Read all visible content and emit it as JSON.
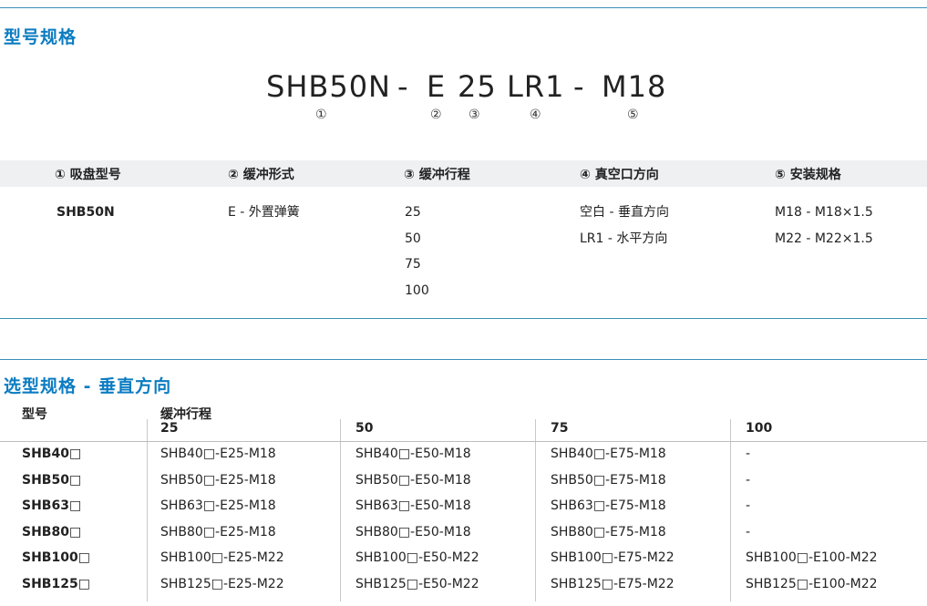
{
  "section1_title": "型号规格",
  "model_code": {
    "parts": [
      "SHB50N",
      "-",
      "E",
      "25",
      "LR1",
      "-",
      "M18"
    ],
    "markers": [
      "①",
      "②",
      "③",
      "④",
      "⑤"
    ]
  },
  "spec_table": {
    "headers": [
      "① 吸盘型号",
      "② 缓冲形式",
      "③ 缓冲行程",
      "④ 真空口方向",
      "⑤ 安装规格"
    ],
    "columns": [
      [
        "SHB50N"
      ],
      [
        "E - 外置弹簧"
      ],
      [
        "25",
        "50",
        "75",
        "100"
      ],
      [
        "空白 - 垂直方向",
        "LR1 - 水平方向"
      ],
      [
        "M18 - M18×1.5",
        "M22 - M22×1.5"
      ]
    ]
  },
  "section2_title": "选型规格 - 垂直方向",
  "selection_table": {
    "model_header": "型号",
    "stroke_header": "缓冲行程",
    "stroke_values": [
      "25",
      "50",
      "75",
      "100"
    ],
    "rows": [
      {
        "model": "SHB40□",
        "cells": [
          "SHB40□-E25-M18",
          "SHB40□-E50-M18",
          "SHB40□-E75-M18",
          "-"
        ]
      },
      {
        "model": "SHB50□",
        "cells": [
          "SHB50□-E25-M18",
          "SHB50□-E50-M18",
          "SHB50□-E75-M18",
          "-"
        ]
      },
      {
        "model": "SHB63□",
        "cells": [
          "SHB63□-E25-M18",
          "SHB63□-E50-M18",
          "SHB63□-E75-M18",
          "-"
        ]
      },
      {
        "model": "SHB80□",
        "cells": [
          "SHB80□-E25-M18",
          "SHB80□-E50-M18",
          "SHB80□-E75-M18",
          "-"
        ]
      },
      {
        "model": "SHB100□",
        "cells": [
          "SHB100□-E25-M22",
          "SHB100□-E50-M22",
          "SHB100□-E75-M22",
          "SHB100□-E100-M22"
        ]
      },
      {
        "model": "SHB125□",
        "cells": [
          "SHB125□-E25-M22",
          "SHB125□-E50-M22",
          "SHB125□-E75-M22",
          "SHB125□-E100-M22"
        ]
      }
    ]
  },
  "colors": {
    "accent": "#0b7cc1",
    "rule": "#3a8fb7",
    "header_bg": "#eef0f2"
  }
}
